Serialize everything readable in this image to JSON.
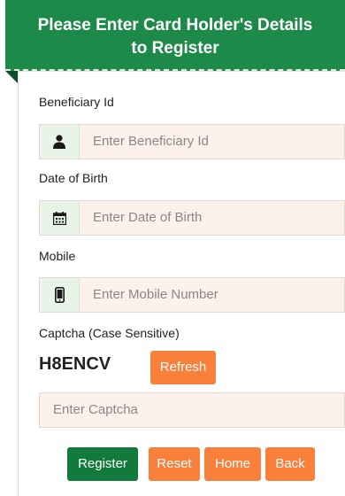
{
  "header": {
    "title_line1": "Please Enter Card Holder's Details",
    "title_line2": "to Register"
  },
  "form": {
    "beneficiary": {
      "label": "Beneficiary Id",
      "placeholder": "Enter Beneficiary Id",
      "icon": "user-icon"
    },
    "dob": {
      "label": "Date of Birth",
      "placeholder": "Enter Date of Birth",
      "icon": "calendar-icon"
    },
    "mobile": {
      "label": "Mobile",
      "placeholder": "Enter Mobile Number",
      "icon": "mobile-icon"
    },
    "captcha": {
      "label": "Captcha (Case Sensitive)",
      "code": "H8ENCV",
      "refresh_label": "Refresh",
      "placeholder": "Enter Captcha"
    }
  },
  "buttons": {
    "register": "Register",
    "reset": "Reset",
    "home": "Home",
    "back": "Back"
  },
  "colors": {
    "brand_green": "#1e8a4a",
    "accent_orange": "#f9803a",
    "input_bg": "#fdf1eb"
  }
}
